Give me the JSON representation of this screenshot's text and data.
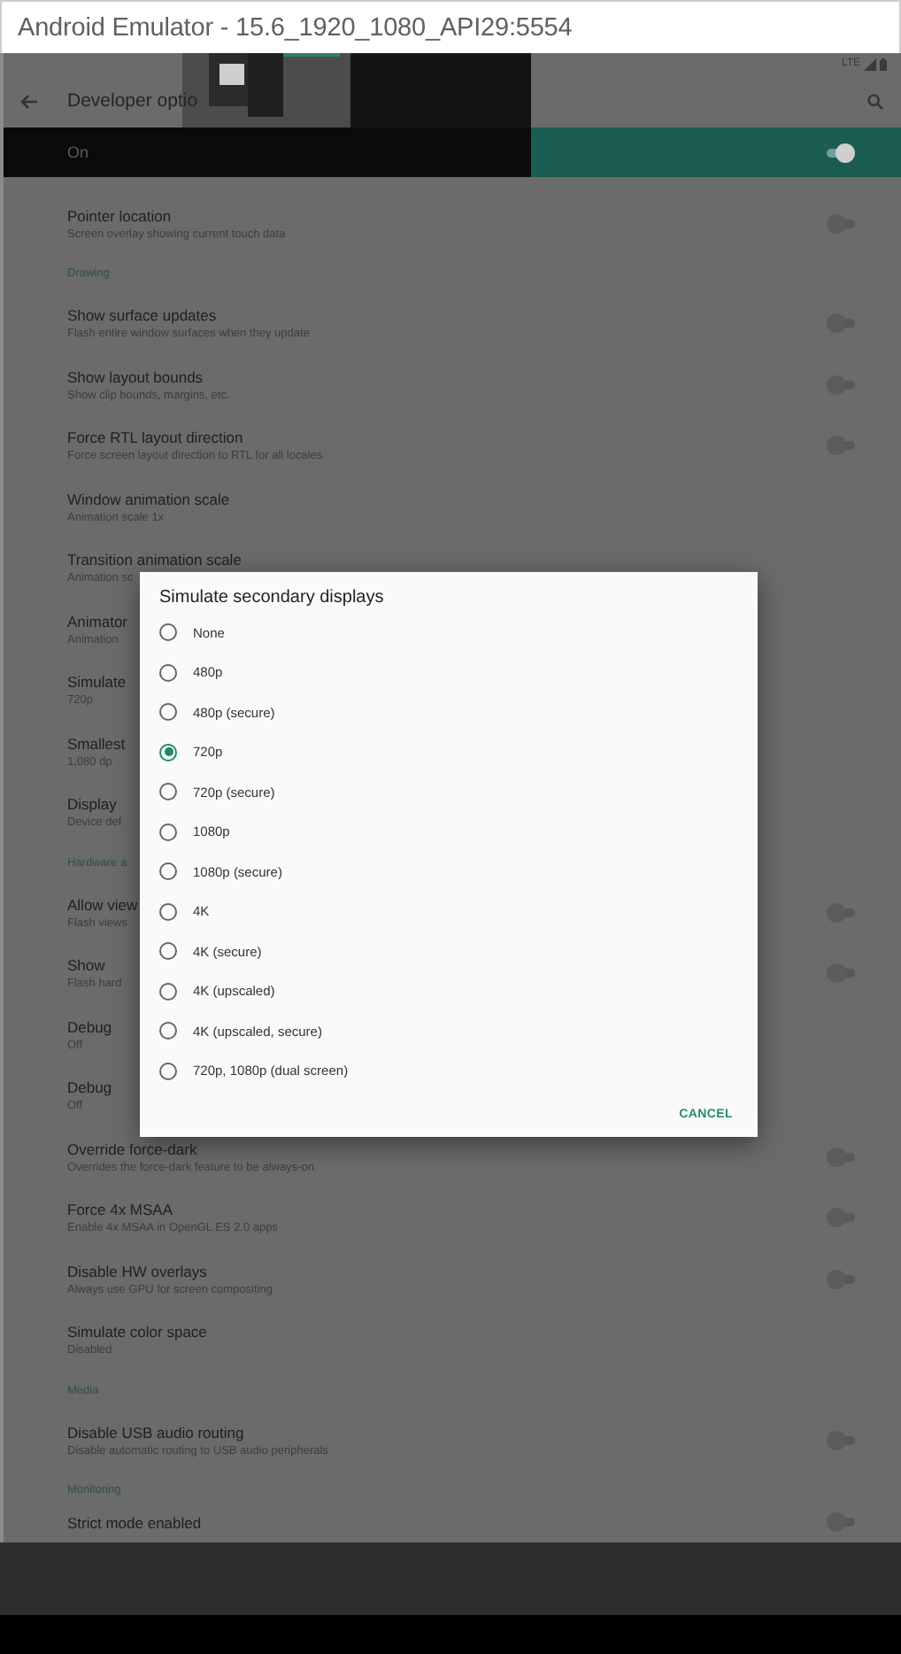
{
  "window": {
    "title": "Android Emulator - 15.6_1920_1080_API29:5554"
  },
  "status_bar": {
    "network": "LTE"
  },
  "app_bar": {
    "title": "Developer optio"
  },
  "main_switch": {
    "label": "On",
    "on": true
  },
  "settings": [
    {
      "kind": "toggle",
      "title": "Pointer location",
      "subtitle": "Screen overlay showing current touch data",
      "on": false
    },
    {
      "kind": "header",
      "title": "Drawing"
    },
    {
      "kind": "toggle",
      "title": "Show surface updates",
      "subtitle": "Flash entire window surfaces when they update",
      "on": false
    },
    {
      "kind": "toggle",
      "title": "Show layout bounds",
      "subtitle": "Show clip bounds, margins, etc.",
      "on": false
    },
    {
      "kind": "toggle",
      "title": "Force RTL layout direction",
      "subtitle": "Force screen layout direction to RTL for all locales",
      "on": false
    },
    {
      "kind": "value",
      "title": "Window animation scale",
      "subtitle": "Animation scale 1x"
    },
    {
      "kind": "value",
      "title": "Transition animation scale",
      "subtitle": "Animation sc"
    },
    {
      "kind": "value",
      "title": "Animator",
      "subtitle": "Animation"
    },
    {
      "kind": "value",
      "title": "Simulate",
      "subtitle": "720p"
    },
    {
      "kind": "value",
      "title": "Smallest",
      "subtitle": "1,080 dp"
    },
    {
      "kind": "value",
      "title": "Display",
      "subtitle": "Device def"
    },
    {
      "kind": "header",
      "title": "Hardware a"
    },
    {
      "kind": "toggle",
      "title": "Allow view",
      "subtitle": "Flash views",
      "on": false
    },
    {
      "kind": "toggle",
      "title": "Show",
      "subtitle": "Flash hard",
      "on": false
    },
    {
      "kind": "value",
      "title": "Debug",
      "subtitle": "Off"
    },
    {
      "kind": "value",
      "title": "Debug",
      "subtitle": "Off"
    },
    {
      "kind": "toggle",
      "title": "Override force-dark",
      "subtitle": "Overrides the force-dark feature to be always-on",
      "on": false
    },
    {
      "kind": "toggle",
      "title": "Force 4x MSAA",
      "subtitle": "Enable 4x MSAA in OpenGL ES 2.0 apps",
      "on": false
    },
    {
      "kind": "toggle",
      "title": "Disable HW overlays",
      "subtitle": "Always use GPU for screen compositing",
      "on": false
    },
    {
      "kind": "value",
      "title": "Simulate color space",
      "subtitle": "Disabled"
    },
    {
      "kind": "header",
      "title": "Media"
    },
    {
      "kind": "toggle",
      "title": "Disable USB audio routing",
      "subtitle": "Disable automatic routing to USB audio peripherals",
      "on": false
    },
    {
      "kind": "header",
      "title": "Monitoring"
    },
    {
      "kind": "toggle",
      "title": "Strict mode enabled",
      "on": false
    }
  ],
  "dialog": {
    "title": "Simulate secondary displays",
    "options": [
      {
        "label": "None",
        "selected": false
      },
      {
        "label": "480p",
        "selected": false
      },
      {
        "label": "480p (secure)",
        "selected": false
      },
      {
        "label": "720p",
        "selected": true
      },
      {
        "label": "720p (secure)",
        "selected": false
      },
      {
        "label": "1080p",
        "selected": false
      },
      {
        "label": "1080p (secure)",
        "selected": false
      },
      {
        "label": "4K",
        "selected": false
      },
      {
        "label": "4K (secure)",
        "selected": false
      },
      {
        "label": "4K (upscaled)",
        "selected": false
      },
      {
        "label": "4K (upscaled, secure)",
        "selected": false
      },
      {
        "label": "720p, 1080p (dual screen)",
        "selected": false
      }
    ],
    "button": "CANCEL"
  }
}
